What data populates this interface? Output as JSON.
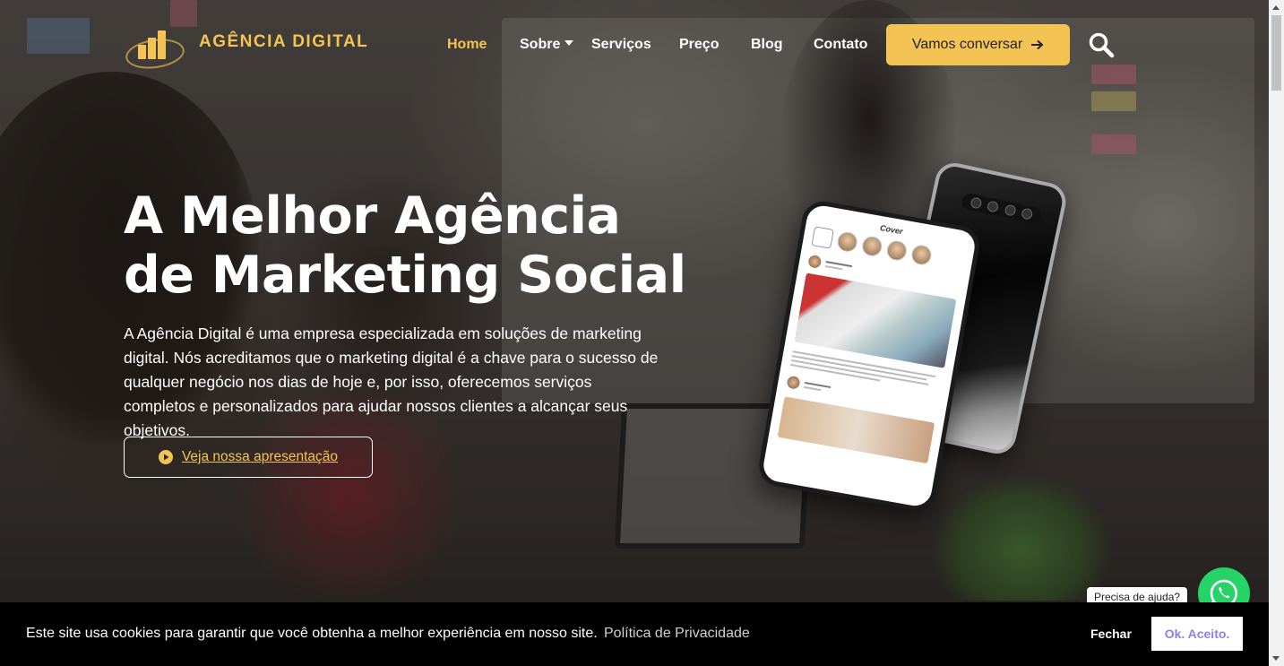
{
  "header": {
    "logo_text": "AGÊNCIA DIGITAL",
    "nav": [
      {
        "label": "Home",
        "active": true
      },
      {
        "label": "Sobre",
        "dropdown": true
      },
      {
        "label": "Serviços"
      },
      {
        "label": "Preço"
      },
      {
        "label": "Blog"
      },
      {
        "label": "Contato"
      }
    ],
    "cta_label": "Vamos conversar",
    "cta_icon": "arrow-right-icon",
    "search_icon": "search-icon"
  },
  "hero": {
    "title_line1": "A Melhor Agência",
    "title_line2": "de Marketing Social",
    "description": "A Agência Digital é uma empresa especializada em soluções de marketing digital. Nós acreditamos que o marketing digital é a chave para o sucesso de qualquer negócio nos dias de hoje e, por isso, oferecemos serviços completos e personalizados para ajudar nossos clientes a alcançar seus objetivos.",
    "button_label": "Veja nossa apresentação",
    "button_icon": "play-circle-icon"
  },
  "phone": {
    "app_title": "Cover"
  },
  "whatsapp": {
    "bubble_text": "Precisa de ajuda?",
    "icon": "whatsapp-icon"
  },
  "cookie": {
    "message": "Este site usa cookies para garantir que você obtenha a melhor experiência em nosso site.",
    "policy_link": "Política de Privacidade",
    "dismiss_label": "Fechar",
    "accept_label": "Ok. Aceito."
  },
  "colors": {
    "accent": "#f3c454",
    "cookie_bg": "#000000",
    "accept_text": "#8f7ee6",
    "whatsapp": "#25d366"
  }
}
